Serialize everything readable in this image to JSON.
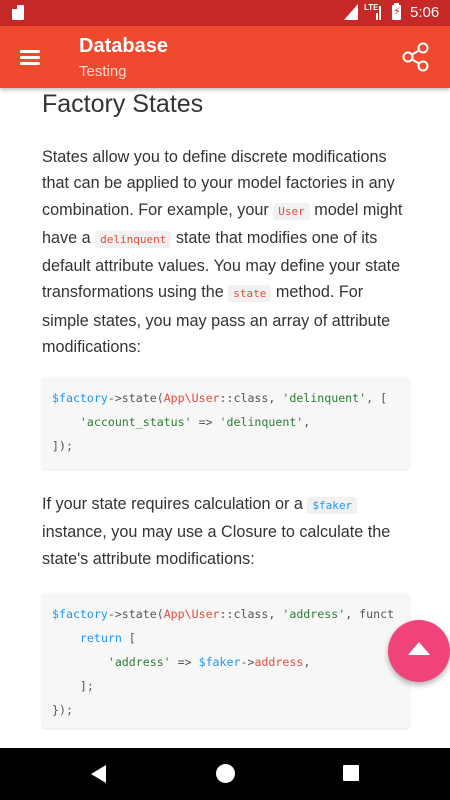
{
  "status_bar": {
    "network": "LTE",
    "time": "5:06"
  },
  "app_bar": {
    "title": "Database",
    "subtitle": "Testing"
  },
  "content": {
    "heading": "Factory States",
    "para1": {
      "t1": "States allow you to define discrete modifications that can be applied to your model factories in any combination. For example, your ",
      "code1": "User",
      "t2": " model might have a ",
      "code2": "delinquent",
      "t3": " state that modifies one of its default attribute values. You may define your state transformations using the ",
      "code3": "state",
      "t4": " method. For simple states, you may pass an array of attribute modifications:"
    },
    "code_block_1": {
      "line1": {
        "var": "$factory",
        "call": "->state(",
        "cls": "App\\User",
        "sep": "::class, ",
        "str": "'delinquent'",
        "tail": ", ["
      },
      "line2": {
        "indent": "    ",
        "key": "'account_status'",
        "arrow": " => ",
        "val": "'delinquent'",
        "tail": ","
      },
      "line3": "]);"
    },
    "para2": {
      "t1": "If your state requires calculation or a ",
      "code1": "$faker",
      "t2": " instance, you may use a Closure to calculate the state's attribute modifications:"
    },
    "code_block_2": {
      "line1": {
        "var": "$factory",
        "call": "->state(",
        "cls": "App\\User",
        "sep": "::class, ",
        "str": "'address'",
        "tail": ", funct"
      },
      "line2": {
        "indent": "    ",
        "kw": "return",
        "tail": " ["
      },
      "line3": {
        "indent": "        ",
        "key": "'address'",
        "arrow": " => ",
        "var": "$faker",
        "op": "->",
        "prop": "address",
        "tail": ","
      },
      "line4": "    ];",
      "line5": "});"
    }
  },
  "icons": {
    "menu": "hamburger-menu-icon",
    "share": "share-icon",
    "fab": "chevron-up-icon"
  },
  "colors": {
    "app_bar": "#ef4a2f",
    "status_bar": "#c62828",
    "fab": "#f0437a",
    "code_var": "#2196f3",
    "code_class": "#e74c3c",
    "code_string": "#2e7d32"
  }
}
